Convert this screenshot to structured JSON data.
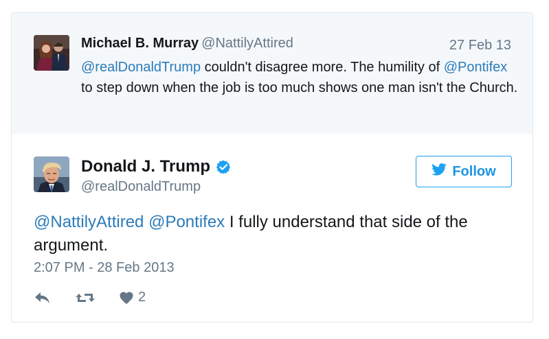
{
  "quoted": {
    "name": "Michael B. Murray",
    "handle": "@NattilyAttired",
    "date": "27 Feb 13",
    "mention1": "@realDonaldTrump",
    "text1": " couldn't disagree more. The humility of ",
    "mention2": "@Pontifex",
    "text2": " to step down when the job is too much shows one man isn't the Church."
  },
  "tweet": {
    "name": "Donald J. Trump",
    "handle": "@realDonaldTrump",
    "follow_label": "Follow",
    "mention1": "@NattilyAttired",
    "mention2": "@Pontifex",
    "text": " I fully understand that side of the argument.",
    "timestamp": "2:07 PM - 28 Feb 2013",
    "like_count": "2"
  },
  "icons": {
    "verified": "verified-badge-icon",
    "bird": "twitter-bird-icon",
    "reply": "reply-icon",
    "retweet": "retweet-icon",
    "like": "heart-icon"
  },
  "colors": {
    "accent": "#1da1f2",
    "mention": "#2b7bb9",
    "muted": "#657786",
    "quoted_bg": "#f5f8fa"
  }
}
